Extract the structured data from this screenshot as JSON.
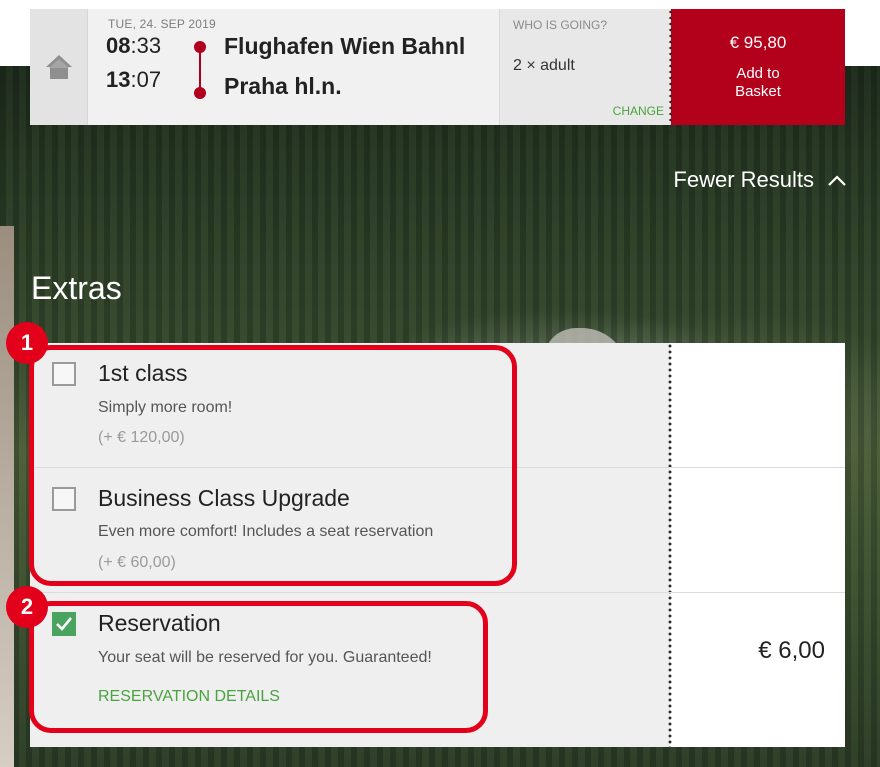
{
  "header": {
    "date": "TUE, 24. SEP 2019",
    "departure": {
      "hh": "08",
      "mm": ":33"
    },
    "arrival": {
      "hh": "13",
      "mm": ":07"
    },
    "from_station": "Flughafen Wien Bahnl",
    "to_station": "Praha hl.n.",
    "who_title": "WHO IS GOING?",
    "who_value": "2 × adult",
    "change_label": "CHANGE",
    "price": "€ 95,80",
    "add_to_basket": "Add to Basket",
    "accent_color": "#b3001b"
  },
  "results_toggle": {
    "label": "Fewer Results"
  },
  "extras": {
    "heading": "Extras",
    "items": [
      {
        "title": "1st class",
        "desc": "Simply more room!",
        "price": "(+ € 120,00)",
        "checked": false
      },
      {
        "title": "Business Class Upgrade",
        "desc": "Even more comfort! Includes a seat reservation",
        "price": "(+ € 60,00)",
        "checked": false
      },
      {
        "title": "Reservation",
        "desc": "Your seat will be reserved for you. Guaranteed!",
        "link": "RESERVATION DETAILS",
        "right_price": "€ 6,00",
        "checked": true
      }
    ]
  },
  "annotations": {
    "badge1": "1",
    "badge2": "2",
    "color": "#e2001a"
  },
  "icons": {
    "home": "home-icon",
    "chevron": "chevron-up-icon",
    "check": "checkmark-icon"
  }
}
